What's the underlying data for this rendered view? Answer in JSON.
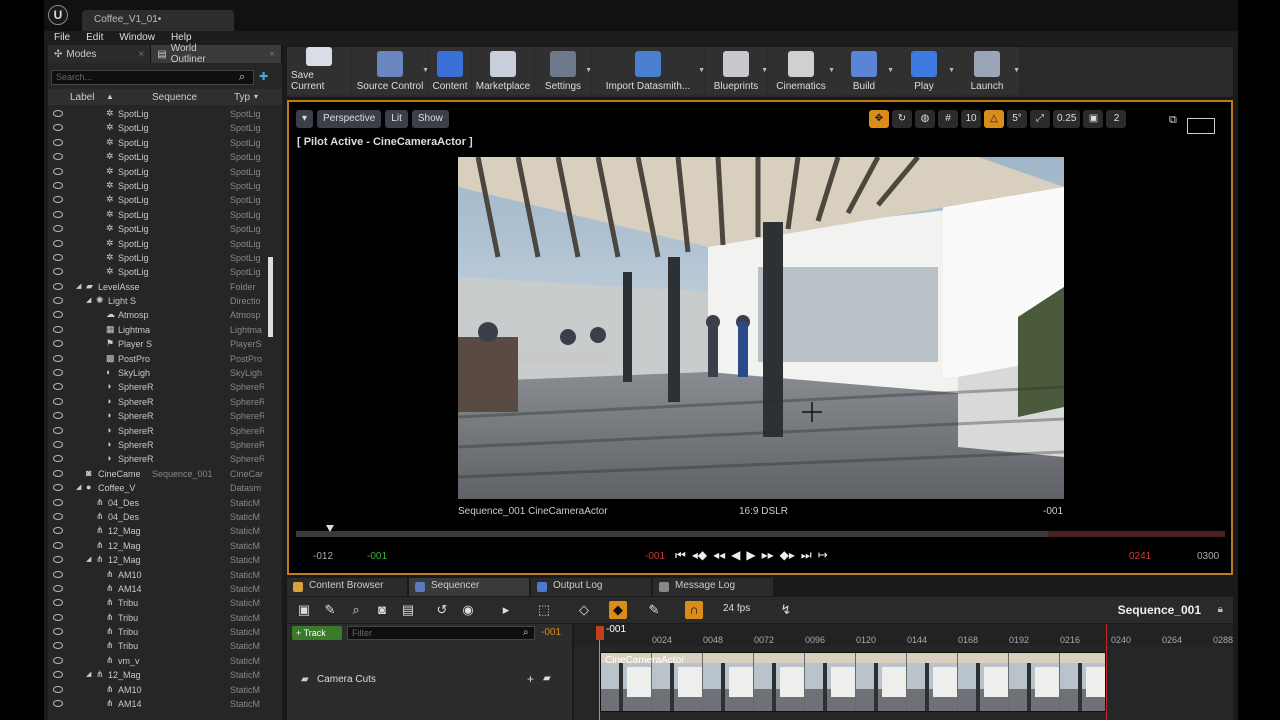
{
  "document_tab": "Coffee_V1_01•",
  "menu": [
    "File",
    "Edit",
    "Window",
    "Help"
  ],
  "left_tabs": [
    {
      "label": "Modes"
    },
    {
      "label": "World Outliner"
    }
  ],
  "search_placeholder": "Search...",
  "columns": {
    "label": "Label",
    "sequence": "Sequence",
    "type": "Typ"
  },
  "outliner_rows": [
    {
      "label": "SpotLig",
      "type": "SpotLig",
      "indent": 2,
      "icon": "spotlight-icon"
    },
    {
      "label": "SpotLig",
      "type": "SpotLig",
      "indent": 2,
      "icon": "spotlight-icon"
    },
    {
      "label": "SpotLig",
      "type": "SpotLig",
      "indent": 2,
      "icon": "spotlight-icon"
    },
    {
      "label": "SpotLig",
      "type": "SpotLig",
      "indent": 2,
      "icon": "spotlight-icon"
    },
    {
      "label": "SpotLig",
      "type": "SpotLig",
      "indent": 2,
      "icon": "spotlight-icon"
    },
    {
      "label": "SpotLig",
      "type": "SpotLig",
      "indent": 2,
      "icon": "spotlight-icon"
    },
    {
      "label": "SpotLig",
      "type": "SpotLig",
      "indent": 2,
      "icon": "spotlight-icon"
    },
    {
      "label": "SpotLig",
      "type": "SpotLig",
      "indent": 2,
      "icon": "spotlight-icon"
    },
    {
      "label": "SpotLig",
      "type": "SpotLig",
      "indent": 2,
      "icon": "spotlight-icon"
    },
    {
      "label": "SpotLig",
      "type": "SpotLig",
      "indent": 2,
      "icon": "spotlight-icon"
    },
    {
      "label": "SpotLig",
      "type": "SpotLig",
      "indent": 2,
      "icon": "spotlight-icon"
    },
    {
      "label": "SpotLig",
      "type": "SpotLig",
      "indent": 2,
      "icon": "spotlight-icon"
    },
    {
      "label": "LevelAsse",
      "type": "Folder",
      "indent": 0,
      "icon": "folder-icon",
      "arrow": "down"
    },
    {
      "label": "Light S",
      "type": "Directio",
      "indent": 1,
      "icon": "directional-light-icon",
      "arrow": "down"
    },
    {
      "label": "Atmosp",
      "type": "Atmosp",
      "indent": 2,
      "icon": "atmosphere-icon"
    },
    {
      "label": "Lightma",
      "type": "Lightma",
      "indent": 2,
      "icon": "lightmass-icon"
    },
    {
      "label": "Player S",
      "type": "PlayerS",
      "indent": 2,
      "icon": "player-start-icon"
    },
    {
      "label": "PostPro",
      "type": "PostPro",
      "indent": 2,
      "icon": "postprocess-icon"
    },
    {
      "label": "SkyLigh",
      "type": "SkyLigh",
      "indent": 2,
      "icon": "skylight-icon"
    },
    {
      "label": "SphereR",
      "type": "SphereR",
      "indent": 2,
      "icon": "sphere-reflection-icon"
    },
    {
      "label": "SphereR",
      "type": "SphereR",
      "indent": 2,
      "icon": "sphere-reflection-icon"
    },
    {
      "label": "SphereR",
      "type": "SphereR",
      "indent": 2,
      "icon": "sphere-reflection-icon"
    },
    {
      "label": "SphereR",
      "type": "SphereR",
      "indent": 2,
      "icon": "sphere-reflection-icon"
    },
    {
      "label": "SphereR",
      "type": "SphereR",
      "indent": 2,
      "icon": "sphere-reflection-icon"
    },
    {
      "label": "SphereR",
      "type": "SphereR",
      "indent": 2,
      "icon": "sphere-reflection-icon"
    },
    {
      "label": "CineCame",
      "sequence": "Sequence_001",
      "type": "CineCar",
      "indent": 0,
      "icon": "camera-icon"
    },
    {
      "label": "Coffee_V",
      "type": "Datasm",
      "indent": 0,
      "icon": "datasmith-icon",
      "arrow": "down"
    },
    {
      "label": "04_Des",
      "type": "StaticM",
      "indent": 1,
      "icon": "mesh-icon"
    },
    {
      "label": "04_Des",
      "type": "StaticM",
      "indent": 1,
      "icon": "mesh-icon"
    },
    {
      "label": "12_Mag",
      "type": "StaticM",
      "indent": 1,
      "icon": "mesh-icon"
    },
    {
      "label": "12_Mag",
      "type": "StaticM",
      "indent": 1,
      "icon": "mesh-icon"
    },
    {
      "label": "12_Mag",
      "type": "StaticM",
      "indent": 1,
      "icon": "mesh-icon",
      "arrow": "down"
    },
    {
      "label": "AM10",
      "type": "StaticM",
      "indent": 2,
      "icon": "mesh-icon"
    },
    {
      "label": "AM14",
      "type": "StaticM",
      "indent": 2,
      "icon": "mesh-icon"
    },
    {
      "label": "Tribu",
      "type": "StaticM",
      "indent": 2,
      "icon": "mesh-icon"
    },
    {
      "label": "Tribu",
      "type": "StaticM",
      "indent": 2,
      "icon": "mesh-icon"
    },
    {
      "label": "Tribu",
      "type": "StaticM",
      "indent": 2,
      "icon": "mesh-icon"
    },
    {
      "label": "Tribu",
      "type": "StaticM",
      "indent": 2,
      "icon": "mesh-icon"
    },
    {
      "label": "vm_v",
      "type": "StaticM",
      "indent": 2,
      "icon": "mesh-icon"
    },
    {
      "label": "12_Mag",
      "type": "StaticM",
      "indent": 1,
      "icon": "mesh-icon",
      "arrow": "down"
    },
    {
      "label": "AM10",
      "type": "StaticM",
      "indent": 2,
      "icon": "mesh-icon"
    },
    {
      "label": "AM14",
      "type": "StaticM",
      "indent": 2,
      "icon": "mesh-icon"
    }
  ],
  "toolbar": [
    {
      "label": "Save Current",
      "icon": "save-icon",
      "color": "#d8dde6"
    },
    {
      "label": "Source Control",
      "icon": "source-control-icon",
      "color": "#6a86c0",
      "dd": true
    },
    {
      "label": "Content",
      "icon": "content-icon",
      "color": "#3a6fd8"
    },
    {
      "label": "Marketplace",
      "icon": "marketplace-icon",
      "color": "#c9cedb"
    },
    {
      "label": "Settings",
      "icon": "settings-icon",
      "color": "#6e7a8c",
      "dd": true
    },
    {
      "label": "Import Datasmith...",
      "icon": "import-datasmith-icon",
      "color": "#4a7fd0",
      "dd": true
    },
    {
      "label": "Blueprints",
      "icon": "blueprints-icon",
      "color": "#c8c8d0",
      "dd": true
    },
    {
      "label": "Cinematics",
      "icon": "cinematics-icon",
      "color": "#d0d0d0",
      "dd": true
    },
    {
      "label": "Build",
      "icon": "build-icon",
      "color": "#5a84d4",
      "dd": true
    },
    {
      "label": "Play",
      "icon": "play-icon",
      "color": "#3d7be0",
      "dd": true
    },
    {
      "label": "Launch",
      "icon": "launch-icon",
      "color": "#9aa6b8",
      "dd": true
    }
  ],
  "viewport": {
    "buttons": [
      "Perspective",
      "Lit",
      "Show"
    ],
    "pilot": "[ Pilot Active - CineCameraActor ]",
    "snap": [
      "10",
      "5°",
      "0.25",
      "2"
    ],
    "info_left": "Sequence_001  CineCameraActor",
    "info_mid": "16:9 DSLR",
    "info_right": "-001",
    "range_start": "-012",
    "play_start": "-001",
    "current": "-001",
    "play_end": "0241",
    "range_end": "0300"
  },
  "bottom_tabs": [
    {
      "label": "Content Browser",
      "color": "#d9a23a"
    },
    {
      "label": "Sequencer",
      "color": "#5a7ac0"
    },
    {
      "label": "Output Log",
      "color": "#4a7ad0"
    },
    {
      "label": "Message Log",
      "color": "#888"
    }
  ],
  "sequencer": {
    "name": "Sequence_001",
    "fps": "24 fps",
    "track_button": "+ Track",
    "filter_placeholder": "Filter",
    "current": "-001",
    "playhead_label": "-001",
    "ticks": [
      "0024",
      "0048",
      "0072",
      "0096",
      "0120",
      "0144",
      "0168",
      "0192",
      "0216",
      "0240",
      "0264",
      "0288"
    ],
    "camera_cuts": "Camera Cuts",
    "shot": "CineCameraActor"
  }
}
